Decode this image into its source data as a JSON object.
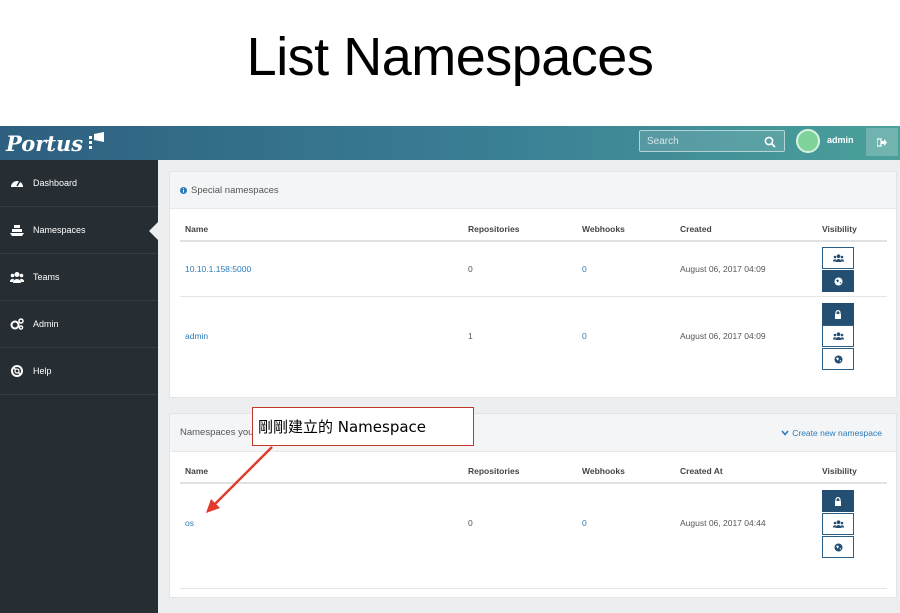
{
  "slide": {
    "title": "List Namespaces"
  },
  "app": {
    "logo_text": "Portus",
    "search_placeholder": "Search",
    "user": "admin"
  },
  "sidebar": {
    "items": [
      {
        "label": "Dashboard",
        "icon": "dashboard-icon"
      },
      {
        "label": "Namespaces",
        "icon": "namespace-icon"
      },
      {
        "label": "Teams",
        "icon": "users-icon"
      },
      {
        "label": "Admin",
        "icon": "gears-icon"
      },
      {
        "label": "Help",
        "icon": "lifebuoy-icon"
      }
    ]
  },
  "special": {
    "heading": "Special namespaces",
    "columns": {
      "name": "Name",
      "repos": "Repositories",
      "hooks": "Webhooks",
      "created": "Created",
      "visibility": "Visibility"
    },
    "rows": [
      {
        "name": "10.10.1.158:5000",
        "repos": "0",
        "hooks": "0",
        "created": "August 06, 2017 04:09",
        "visibility": "public"
      },
      {
        "name": "admin",
        "repos": "1",
        "hooks": "0",
        "created": "August 06, 2017 04:09",
        "visibility": "private"
      }
    ]
  },
  "owned": {
    "heading": "Namespaces you",
    "create_label": "Create new namespace",
    "columns": {
      "name": "Name",
      "repos": "Repositories",
      "hooks": "Webhooks",
      "created": "Created At",
      "visibility": "Visibility"
    },
    "rows": [
      {
        "name": "os",
        "repos": "0",
        "hooks": "0",
        "created": "August 06, 2017 04:44",
        "visibility": "private"
      }
    ]
  },
  "callout": {
    "text": "剛剛建立的 Namespace"
  },
  "colors": {
    "accent": "#2b7bb9",
    "sidebar": "#262d33",
    "active_button": "#244f73",
    "callout_border": "#c0392b"
  }
}
